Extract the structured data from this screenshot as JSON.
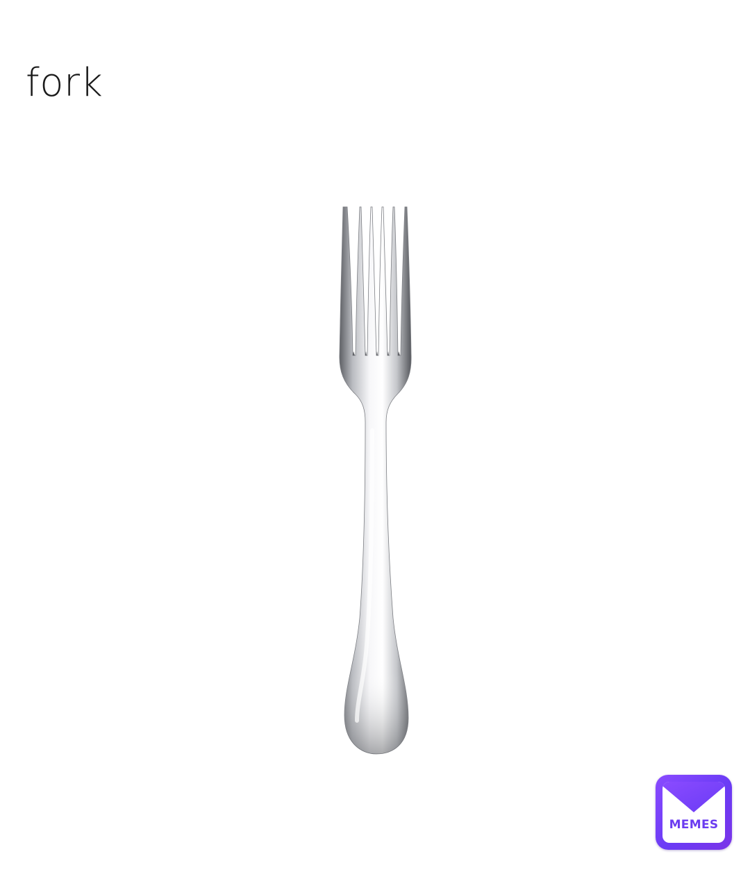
{
  "caption": {
    "text": "fork"
  },
  "image": {
    "subject_icon": "fork-image",
    "colors": {
      "metal_light": "#f4f4f6",
      "metal_mid": "#c9cace",
      "metal_dark": "#6d6f74"
    }
  },
  "watermark": {
    "label": "MEMES",
    "icon": "envelope-logo-icon",
    "colors": {
      "gradient_start": "#8a4bff",
      "gradient_end": "#6a3bf5",
      "text": "#6b3cf0"
    }
  }
}
